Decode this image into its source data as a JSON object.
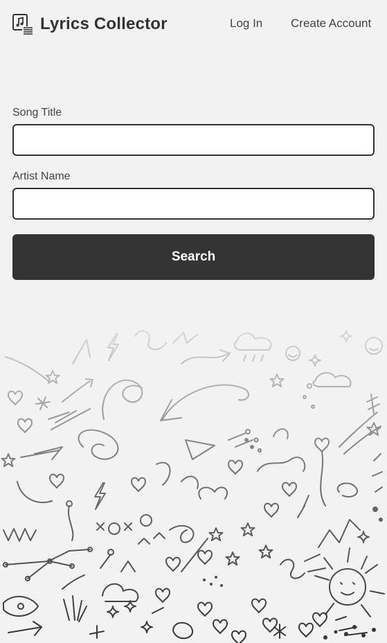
{
  "header": {
    "brand_icon": "music-lyrics-icon",
    "title": "Lyrics Collector",
    "nav": {
      "login": "Log In",
      "create_account": "Create Account"
    }
  },
  "form": {
    "song_title_label": "Song Title",
    "song_title_value": "",
    "artist_name_label": "Artist Name",
    "artist_name_value": "",
    "search_label": "Search"
  },
  "decoration": {
    "type": "hand-drawn doodle pattern",
    "color": "#333333",
    "fade": "top-to-bottom"
  },
  "colors": {
    "background": "#f2f2f2",
    "primary": "#333333",
    "button_text": "#ffffff"
  }
}
